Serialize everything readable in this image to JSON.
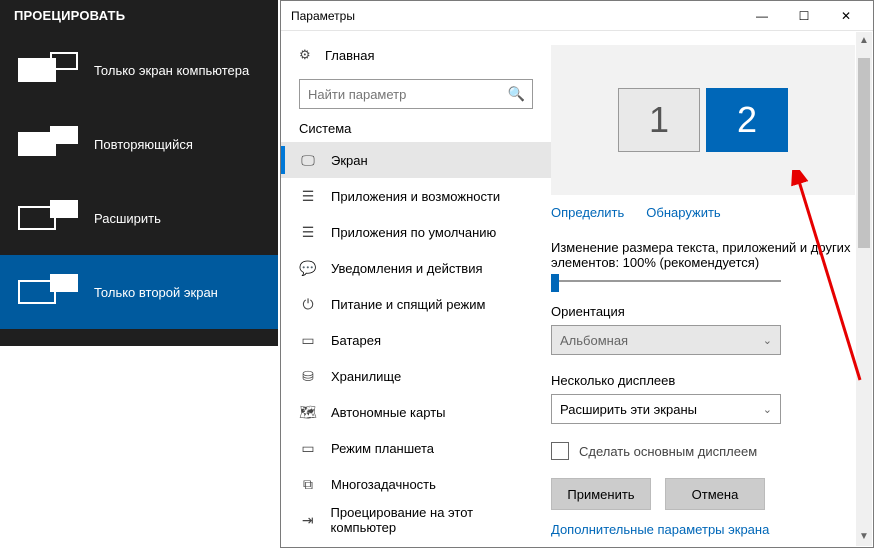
{
  "flyout": {
    "title": "ПРОЕЦИРОВАТЬ",
    "items": [
      {
        "label": "Только экран компьютера"
      },
      {
        "label": "Повторяющийся"
      },
      {
        "label": "Расширить"
      },
      {
        "label": "Только второй экран"
      }
    ]
  },
  "window": {
    "title": "Параметры",
    "home": "Главная",
    "search_placeholder": "Найти параметр",
    "category": "Система",
    "nav": [
      "Экран",
      "Приложения и возможности",
      "Приложения по умолчанию",
      "Уведомления и действия",
      "Питание и спящий режим",
      "Батарея",
      "Хранилище",
      "Автономные карты",
      "Режим планшета",
      "Многозадачность",
      "Проецирование на этот компьютер"
    ]
  },
  "main": {
    "monitor1": "1",
    "monitor2": "2",
    "link_identify": "Определить",
    "link_detect": "Обнаружить",
    "scale_label": "Изменение размера текста, приложений и других элементов: 100% (рекомендуется)",
    "orientation_label": "Ориентация",
    "orientation_value": "Альбомная",
    "multi_label": "Несколько дисплеев",
    "multi_value": "Расширить эти экраны",
    "make_primary": "Сделать основным дисплеем",
    "apply": "Применить",
    "cancel": "Отмена",
    "extra_link": "Дополнительные параметры экрана"
  }
}
